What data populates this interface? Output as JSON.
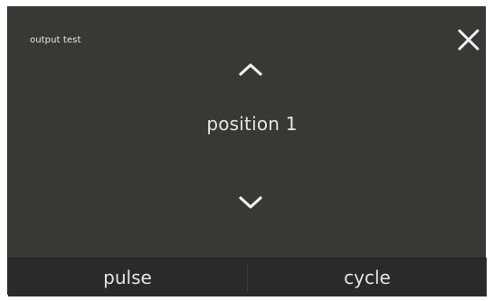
{
  "screen": {
    "title": "output test",
    "position_label": "position 1",
    "icons": {
      "close": "close-icon",
      "up": "chevron-up-icon",
      "down": "chevron-down-icon"
    }
  },
  "bottom_bar": {
    "pulse_label": "pulse",
    "cycle_label": "cycle"
  },
  "colors": {
    "background": "#3a3835",
    "bar_background": "#2b2a28",
    "text": "#e6e4e1"
  }
}
